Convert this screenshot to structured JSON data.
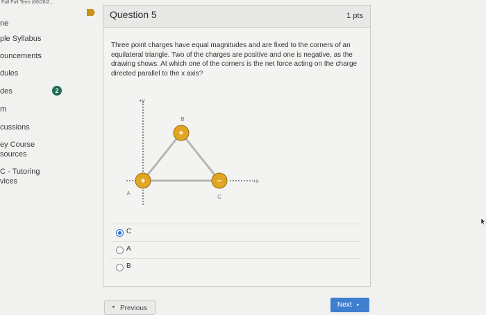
{
  "course": {
    "term_label": "Fall Full Term (08/28/2..."
  },
  "sidebar": {
    "items": [
      {
        "label": "ne"
      },
      {
        "label": "ple Syllabus"
      },
      {
        "label": "ouncements"
      },
      {
        "label": "dules"
      },
      {
        "label": "des",
        "badge": "2"
      },
      {
        "label": "m"
      },
      {
        "label": "cussions"
      },
      {
        "label": "ey Course",
        "label2": "sources"
      },
      {
        "label": "C - Tutoring",
        "label2": "vices"
      }
    ]
  },
  "question": {
    "title": "Question 5",
    "points": "1 pts",
    "text": "Three point charges have equal magnitudes and are fixed to the corners of an equilateral triangle. Two of the charges are positive and one is negative, as the drawing shows. At which one of the corners is the net force acting on the charge directed parallel to the x axis?",
    "figure": {
      "y_axis_label": "+y",
      "x_axis_label": "+x",
      "charges": [
        {
          "corner": "A",
          "sign": "+"
        },
        {
          "corner": "B",
          "sign": "+"
        },
        {
          "corner": "C",
          "sign": "−"
        }
      ]
    },
    "options": [
      {
        "label": "C",
        "selected": true
      },
      {
        "label": "A",
        "selected": false
      },
      {
        "label": "B",
        "selected": false
      }
    ]
  },
  "navigation": {
    "previous_label": "Previous",
    "next_label": "Next",
    "previous_arrow": "◂",
    "next_arrow": "▸"
  },
  "colors": {
    "charge_fill": "#e0a623",
    "selected_radio": "#2a6fd1",
    "next_button": "#3f7fcf",
    "badge": "#1f6a57"
  }
}
